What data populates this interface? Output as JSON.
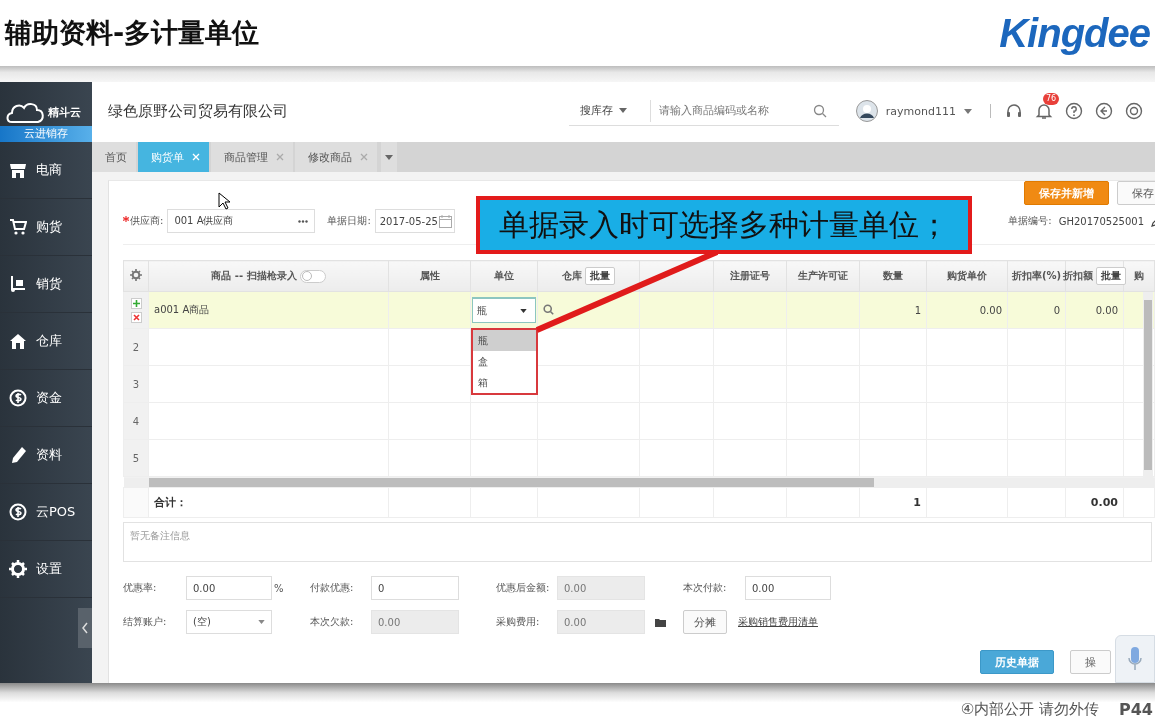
{
  "slide": {
    "title": "辅助资料-多计量单位",
    "logo": "Kingdee",
    "footer_note": "④内部公开 请勿外传",
    "page": "P44"
  },
  "sidebar": {
    "brand": "精斗云",
    "product": "云进销存",
    "items": [
      {
        "label": "电商"
      },
      {
        "label": "购货"
      },
      {
        "label": "销货"
      },
      {
        "label": "仓库"
      },
      {
        "label": "资金"
      },
      {
        "label": "资料"
      },
      {
        "label": "云POS"
      },
      {
        "label": "设置"
      }
    ]
  },
  "header": {
    "company": "绿色原野公司贸易有限公司",
    "search_scope": "搜库存",
    "search_placeholder": "请输入商品编码或名称",
    "user": "raymond111",
    "notification_count": "76"
  },
  "tabs": [
    {
      "label": "首页",
      "selected": false,
      "closable": false
    },
    {
      "label": "购货单",
      "selected": true,
      "closable": true
    },
    {
      "label": "商品管理",
      "selected": false,
      "closable": true
    },
    {
      "label": "修改商品",
      "selected": false,
      "closable": true
    }
  ],
  "actions": [
    {
      "label": "保存并新增",
      "kind": "accent"
    },
    {
      "label": "保存",
      "kind": "default"
    }
  ],
  "form": {
    "supplier": {
      "label": "供应商:",
      "value": "001 A供应商",
      "required": true
    },
    "date": {
      "label": "单据日期:",
      "value": "2017-05-25"
    },
    "doc_number": {
      "label": "单据编号:",
      "value": "GH20170525001"
    }
  },
  "callout": "单据录入时可选择多种计量单位；",
  "table": {
    "columns": [
      {
        "label": "商品 -- 扫描枪录入",
        "kind": "text",
        "toggle_on": false
      },
      {
        "label": "属性",
        "kind": "text"
      },
      {
        "label": "单位",
        "kind": "unit"
      },
      {
        "label": "仓库",
        "kind": "lookup",
        "button": "批量"
      },
      {
        "kind": "text"
      },
      {
        "label": "注册证号",
        "kind": "text"
      },
      {
        "label": "生产许可证",
        "kind": "text"
      },
      {
        "label": "数量",
        "kind": "number"
      },
      {
        "label": "购货单价",
        "kind": "number"
      },
      {
        "label": "折扣率(%)",
        "kind": "number"
      },
      {
        "label": "折扣额",
        "kind": "number",
        "button": "批量"
      },
      {
        "label": "购",
        "kind": "number"
      }
    ],
    "rows": [
      {
        "selected": true,
        "product": "a001 A商品",
        "unit": {
          "value": "瓶",
          "expanded": true
        },
        "quantity": "1",
        "unit_price": "0.00",
        "discount_rate": "0",
        "discount_amount": "0.00"
      },
      {
        "selected": false,
        "number": "2"
      },
      {
        "selected": false,
        "number": "3"
      },
      {
        "selected": false,
        "number": "4"
      },
      {
        "selected": false,
        "number": "5"
      }
    ],
    "totals": {
      "product": "合计：",
      "quantity": "1",
      "discount_amount": "0.00"
    },
    "unit_menu": {
      "options": [
        {
          "label": "瓶",
          "selected": true
        },
        {
          "label": "盒",
          "selected": false
        },
        {
          "label": "箱",
          "selected": false
        }
      ]
    }
  },
  "remarks": {
    "placeholder": "暂无备注信息"
  },
  "summary": {
    "discount_rate": {
      "label": "优惠率:",
      "value": "0.00",
      "suffix": "%",
      "disabled": false
    },
    "payment_discount": {
      "label": "付款优惠:",
      "value": "0",
      "disabled": false
    },
    "amount_after_discount": {
      "label": "优惠后金额:",
      "value": "0.00",
      "disabled": true
    },
    "payment": {
      "label": "本次付款:",
      "value": "0.00",
      "disabled": false
    },
    "account": {
      "label": "结算账户:",
      "value": "(空)"
    },
    "arrears": {
      "label": "本次欠款:",
      "value": "0.00",
      "disabled": true
    },
    "purchase_fee": {
      "label": "采购费用:",
      "value": "0.00",
      "disabled": true
    },
    "allocate_button": "分摊",
    "fee_list_link": "采购销售费用清单"
  },
  "footer_buttons": [
    {
      "label": "历史单据",
      "kind": "primary"
    },
    {
      "label": "操",
      "kind": "default"
    }
  ]
}
